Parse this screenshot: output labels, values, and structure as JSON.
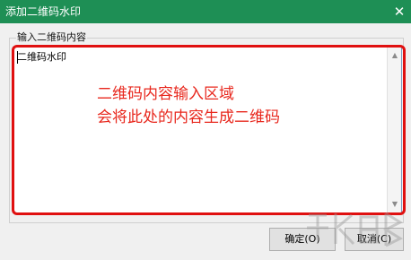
{
  "window": {
    "title": "添加二维码水印",
    "close_glyph": "✕"
  },
  "input_group": {
    "label": "输入二维码内容",
    "value": "二维码水印"
  },
  "annotation": {
    "line1": "二维码内容输入区域",
    "line2": "会将此处的内容生成二维码",
    "color": "#e8281e"
  },
  "buttons": {
    "ok_label": "确定(O)",
    "cancel_label": "取消(C)"
  },
  "colors": {
    "titlebar": "#1e8f55",
    "annotation_border": "#e01010"
  }
}
